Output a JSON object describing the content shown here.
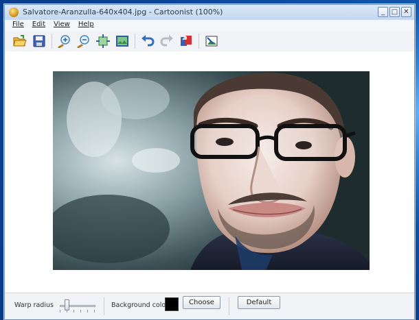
{
  "window": {
    "title": "Salvatore-Aranzulla-640x404.jpg - Cartoonist (100%)",
    "controls": {
      "minimize": "_",
      "maximize": "□",
      "close": "✕"
    }
  },
  "menu": {
    "items": [
      {
        "label": "File"
      },
      {
        "label": "Edit"
      },
      {
        "label": "View"
      },
      {
        "label": "Help"
      }
    ]
  },
  "toolbar": {
    "tools": [
      {
        "icon": "open-folder-icon"
      },
      {
        "icon": "save-icon"
      },
      {
        "icon": "zoom-in-icon"
      },
      {
        "icon": "zoom-out-icon"
      },
      {
        "icon": "fit-to-window-icon"
      },
      {
        "icon": "actual-size-icon"
      },
      {
        "icon": "undo-icon"
      },
      {
        "icon": "redo-icon"
      },
      {
        "icon": "reset-icon"
      },
      {
        "icon": "export-icon"
      }
    ]
  },
  "bottom": {
    "warp_radius_label": "Warp radius",
    "warp_radius_value": 0.15,
    "background_color_label": "Background color",
    "background_color": "#000000",
    "choose_label": "Choose",
    "default_label": "Default"
  }
}
